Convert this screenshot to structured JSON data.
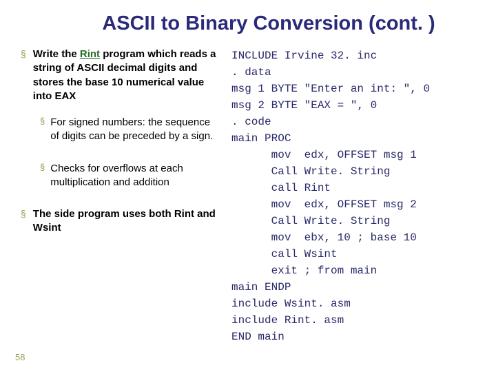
{
  "title": "ASCII to Binary Conversion (cont. )",
  "page_number": "58",
  "left": {
    "b1_pre": "Write the ",
    "b1_rint": "Rint",
    "b1_post": " program which reads a string of ASCII decimal digits and stores the base 10  numerical value into EAX",
    "b2": "For signed numbers: the sequence of digits can be preceded by a sign.",
    "b3": "Checks for overflows at each multiplication and addition",
    "b4": "The side program uses both Rint and Wsint"
  },
  "code": {
    "l1": "INCLUDE Irvine 32. inc",
    "l2": ". data",
    "l3": "msg 1 BYTE \"Enter an int: \", 0",
    "l4": "msg 2 BYTE \"EAX = \", 0",
    "l5": ". code",
    "l6": "main PROC",
    "l7": "      mov  edx, OFFSET msg 1",
    "l8": "      Call Write. String",
    "l9": "      call Rint",
    "l10": "      mov  edx, OFFSET msg 2",
    "l11": "      Call Write. String",
    "l12": "      mov  ebx, 10 ; base 10",
    "l13": "      call Wsint",
    "l14": "      exit ; from main",
    "l15": "main ENDP",
    "l16": "include Wsint. asm",
    "l17": "include Rint. asm",
    "l18": "END main"
  }
}
